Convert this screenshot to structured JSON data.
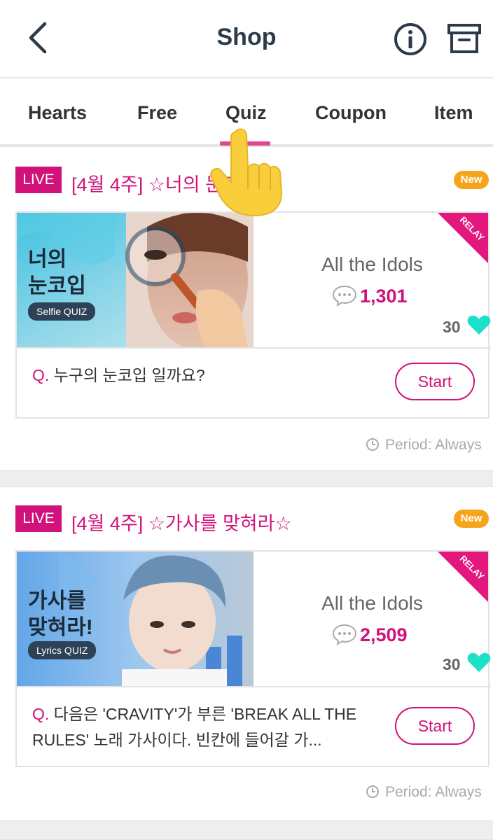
{
  "header": {
    "title": "Shop",
    "back_icon": "chevron-left-icon",
    "info_icon": "info-circle-icon",
    "box_icon": "archive-box-icon"
  },
  "tabs": [
    {
      "label": "Hearts"
    },
    {
      "label": "Free"
    },
    {
      "label": "Quiz",
      "active": true
    },
    {
      "label": "Coupon"
    },
    {
      "label": "Item"
    }
  ],
  "colors": {
    "accent": "#d0127a",
    "tab_indicator": "#e3488e",
    "new_badge": "#f5a41b",
    "heart": "#1de0c8"
  },
  "quizzes": [
    {
      "live_label": "LIVE",
      "title": "[4월 4주] ☆너의 눈코입☆",
      "new_label": "New",
      "relay_label": "RELAY",
      "thumbnail": {
        "title_line1": "너의",
        "title_line2": "눈코입",
        "tag": "Selfie QUIZ"
      },
      "group": "All the Idols",
      "comments": "1,301",
      "cost": "30",
      "question_prefix": "Q.",
      "question": "누구의 눈코입 일까요?",
      "start_label": "Start",
      "period": "Period: Always"
    },
    {
      "live_label": "LIVE",
      "title": "[4월 4주] ☆가사를 맞혀라☆",
      "new_label": "New",
      "relay_label": "RELAY",
      "thumbnail": {
        "title_line1": "가사를",
        "title_line2": "맞혀라!",
        "tag": "Lyrics QUIZ"
      },
      "group": "All the Idols",
      "comments": "2,509",
      "cost": "30",
      "question_prefix": "Q.",
      "question": "다음은 'CRAVITY'가 부른 'BREAK ALL THE RULES' 노래 가사이다. 빈칸에 들어갈 가...",
      "start_label": "Start",
      "period": "Period: Always"
    }
  ]
}
